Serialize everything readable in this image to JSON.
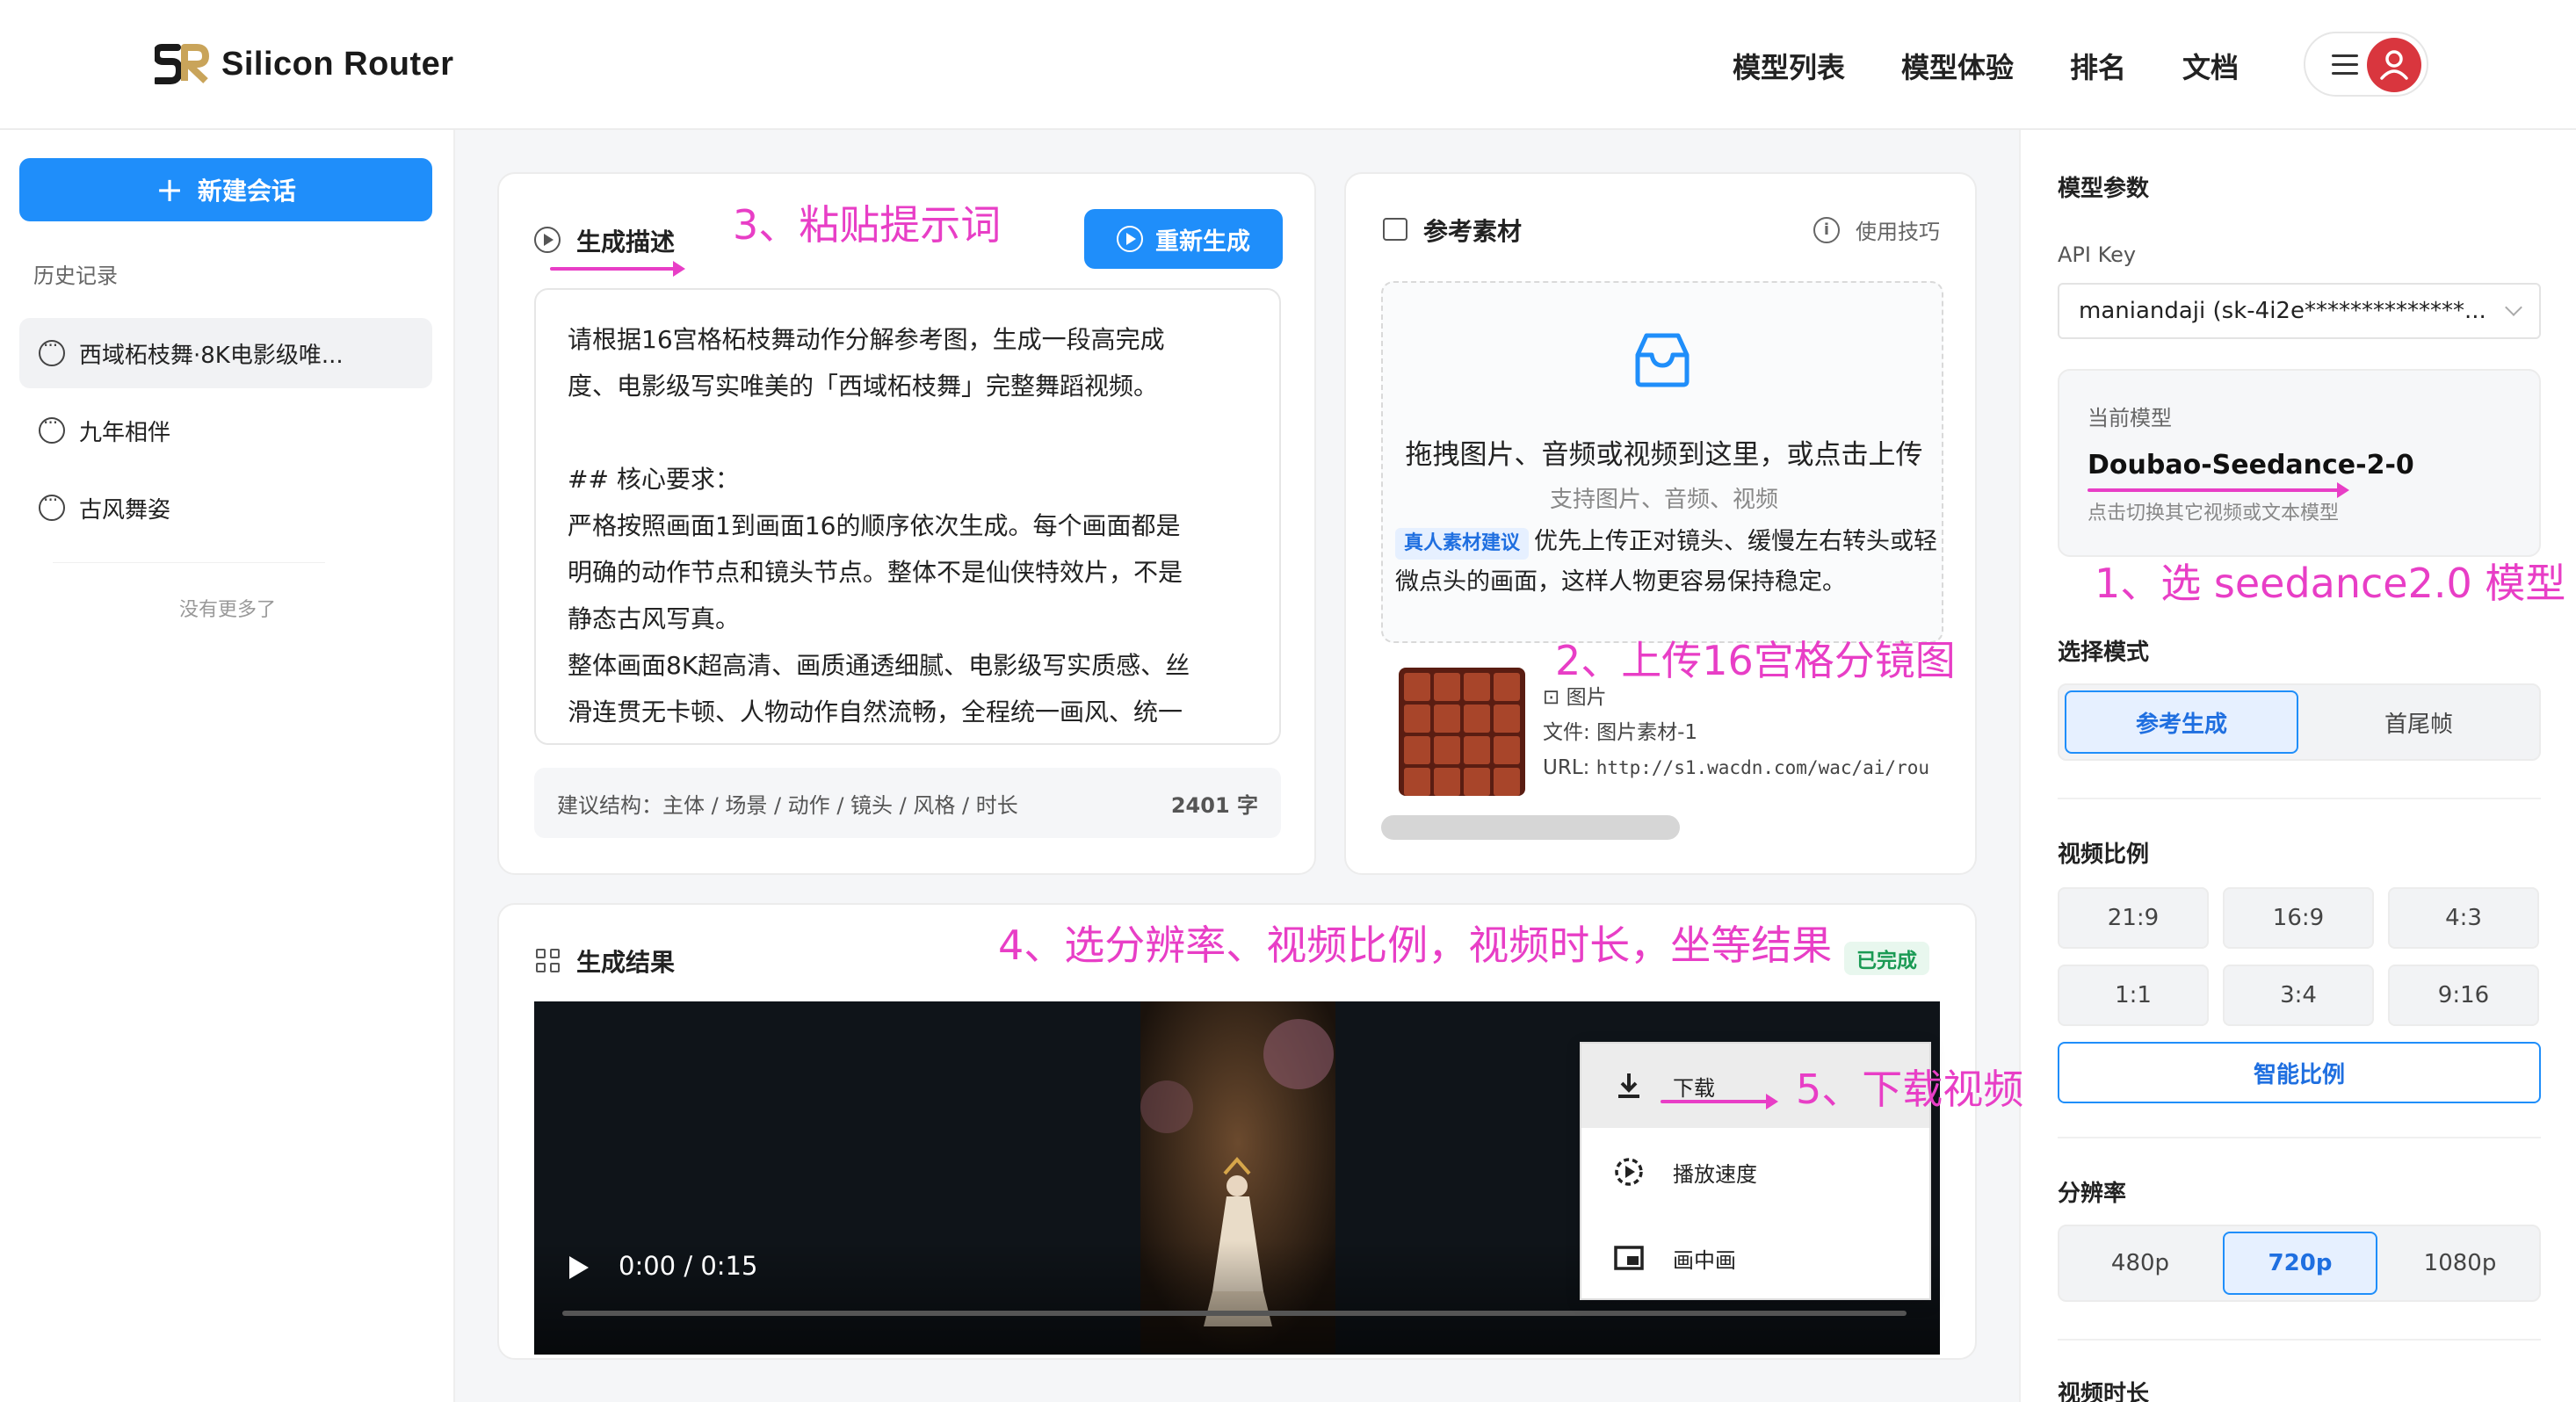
{
  "brand": {
    "logo_initials": "SR",
    "name": "Silicon Router"
  },
  "nav": [
    "模型列表",
    "模型体验",
    "排名",
    "文档"
  ],
  "colors": {
    "primary": "#1f8efa",
    "annotation": "#e83ec6",
    "avatar": "#d9363e",
    "success": "#1a9a54"
  },
  "sidebar": {
    "new_chat": "新建会话",
    "history_title": "历史记录",
    "items": [
      "西域柘枝舞·8K电影级唯...",
      "九年相伴",
      "古风舞姿"
    ],
    "no_more": "没有更多了"
  },
  "description": {
    "title": "生成描述",
    "regenerate": "重新生成",
    "prompt": "请根据16宫格柘枝舞动作分解参考图，生成一段高完成\n度、电影级写实唯美的「西域柘枝舞」完整舞蹈视频。\n\n## 核心要求：\n严格按照画面1到画面16的顺序依次生成。每个画面都是\n明确的动作节点和镜头节点。整体不是仙侠特效片，不是\n静态古风写真。\n整体画面8K超高清、画质通透细腻、电影级写实质感、丝\n滑连贯无卡顿、人物动作自然流畅，全程统一画风、统一",
    "hint": "建议结构：主体 / 场景 / 动作 / 镜头 / 风格 / 时长",
    "count": "2401 字"
  },
  "reference": {
    "title": "参考素材",
    "tips": "使用技巧",
    "upload_main": "拖拽图片、音频或视频到这里，或点击上传",
    "upload_sub": "支持图片、音频、视频",
    "tag": "真人素材建议",
    "tip_text": "优先上传正对镜头、缓慢左右转头或轻微点头的画面，这样人物更容易保持稳定。",
    "asset_type": "图片",
    "file_label": "文件:",
    "file_name": "图片素材-1",
    "url_label": "URL:",
    "url": "http://s1.wacdn.com/wac/ai/rou"
  },
  "result": {
    "title": "生成结果",
    "status": "已完成",
    "time": "0:00 / 0:15",
    "progress": 0,
    "menu": [
      "下载",
      "播放速度",
      "画中画"
    ]
  },
  "params": {
    "title": "模型参数",
    "api_key_label": "API Key",
    "api_key_value": "maniandaji (sk-4i2e**************...",
    "current_model_label": "当前模型",
    "current_model": "Doubao-Seedance-2-0",
    "switch_hint": "点击切换其它视频或文本模型",
    "mode_label": "选择模式",
    "modes": [
      "参考生成",
      "首尾帧"
    ],
    "mode_selected": 0,
    "ratio_label": "视频比例",
    "ratios": [
      "21:9",
      "16:9",
      "4:3",
      "1:1",
      "3:4",
      "9:16"
    ],
    "smart_ratio": "智能比例",
    "resolution_label": "分辨率",
    "resolutions": [
      "480p",
      "720p",
      "1080p"
    ],
    "resolution_selected": 1,
    "duration_label": "视频时长"
  },
  "annotations": {
    "a1": "1、选 seedance2.0 模型",
    "a2": "2、上传16宫格分镜图",
    "a3": "3、粘贴提示词",
    "a4": "4、选分辨率、视频比例，视频时长，坐等结果",
    "a5": "5、下载视频"
  }
}
